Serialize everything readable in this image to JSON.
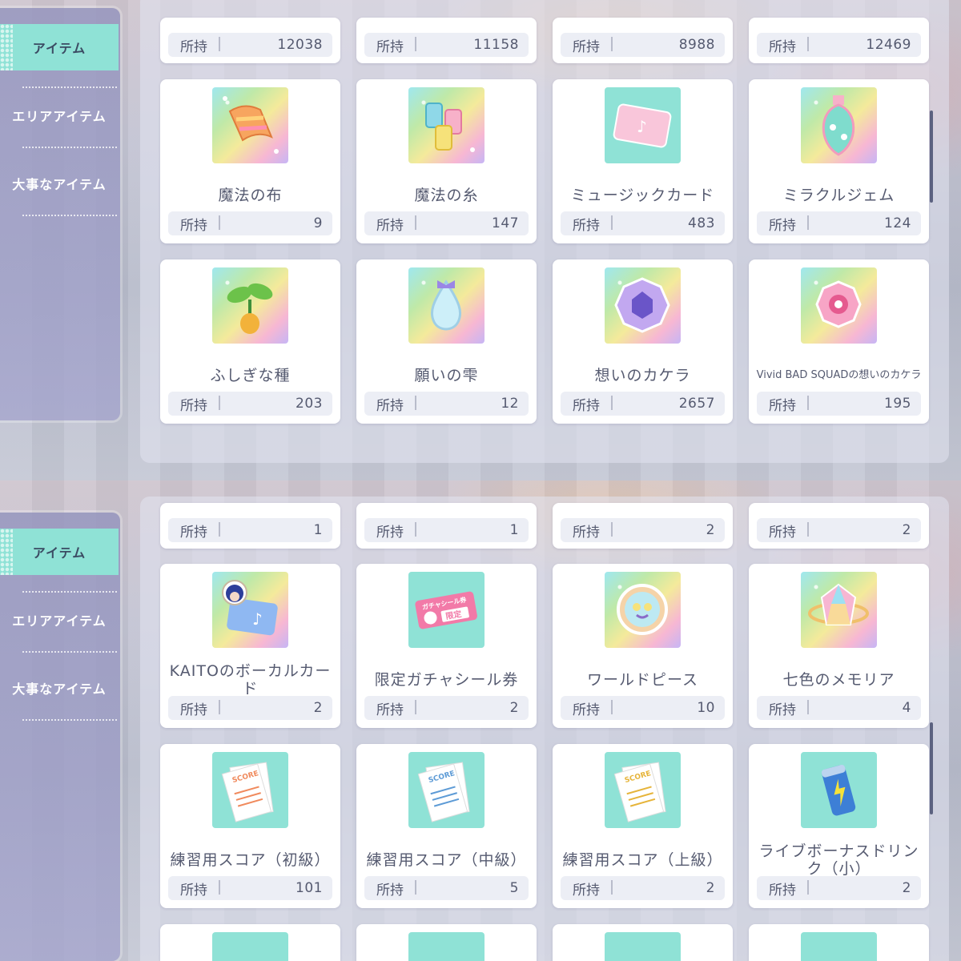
{
  "sidebar": {
    "tabs": [
      {
        "label": "アイテム",
        "active": true
      },
      {
        "label": "エリアアイテム",
        "active": false
      },
      {
        "label": "大事なアイテム",
        "active": false
      }
    ]
  },
  "count_label": "所持",
  "top_screen": {
    "stub_counts": [
      "12038",
      "11158",
      "8988",
      "12469"
    ],
    "items": [
      {
        "name": "魔法の布",
        "count": "9",
        "icon": "magic-cloth-icon"
      },
      {
        "name": "魔法の糸",
        "count": "147",
        "icon": "magic-thread-icon"
      },
      {
        "name": "ミュージックカード",
        "count": "483",
        "icon": "music-card-icon"
      },
      {
        "name": "ミラクルジェム",
        "count": "124",
        "icon": "miracle-gem-icon"
      },
      {
        "name": "ふしぎな種",
        "count": "203",
        "icon": "mysterious-seed-icon"
      },
      {
        "name": "願いの雫",
        "count": "12",
        "icon": "wish-drop-icon"
      },
      {
        "name": "想いのカケラ",
        "count": "2657",
        "icon": "feeling-fragment-icon"
      },
      {
        "name": "Vivid BAD SQUADの想いのカケラ",
        "count": "195",
        "icon": "vbs-fragment-icon"
      }
    ]
  },
  "bottom_screen": {
    "stub_counts": [
      "1",
      "1",
      "2",
      "2"
    ],
    "items": [
      {
        "name": "KAITOのボーカルカード",
        "count": "2",
        "icon": "kaito-vocal-card-icon"
      },
      {
        "name": "限定ガチャシール券",
        "count": "2",
        "icon": "gacha-sticker-ticket-icon",
        "icon_text": "ガチャシール券",
        "icon_badge": "限定"
      },
      {
        "name": "ワールドピース",
        "count": "10",
        "icon": "world-piece-icon"
      },
      {
        "name": "七色のメモリア",
        "count": "4",
        "icon": "rainbow-memoria-icon"
      },
      {
        "name": "練習用スコア（初級）",
        "count": "101",
        "icon": "practice-score-beginner-icon",
        "icon_text": "SCORE"
      },
      {
        "name": "練習用スコア（中級）",
        "count": "5",
        "icon": "practice-score-intermediate-icon",
        "icon_text": "SCORE"
      },
      {
        "name": "練習用スコア（上級）",
        "count": "2",
        "icon": "practice-score-advanced-icon",
        "icon_text": "SCORE"
      },
      {
        "name": "ライブボーナスドリンク（小）",
        "count": "2",
        "icon": "live-bonus-drink-icon"
      }
    ]
  }
}
